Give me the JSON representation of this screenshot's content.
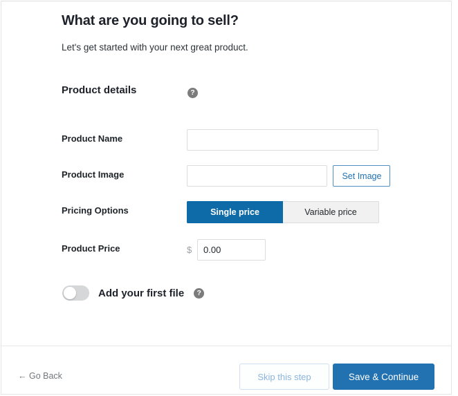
{
  "page": {
    "title": "What are you going to sell?",
    "subtitle": "Let's get started with your next great product."
  },
  "section": {
    "title": "Product details",
    "help_icon": "question-mark-icon",
    "help_glyph": "?"
  },
  "fields": {
    "product_name": {
      "label": "Product Name",
      "value": "",
      "placeholder": ""
    },
    "product_image": {
      "label": "Product Image",
      "value": "",
      "placeholder": "",
      "button_label": "Set Image"
    },
    "pricing_options": {
      "label": "Pricing Options",
      "options": [
        {
          "label": "Single price",
          "active": true
        },
        {
          "label": "Variable price",
          "active": false
        }
      ]
    },
    "product_price": {
      "label": "Product Price",
      "currency": "$",
      "value": "0.00",
      "placeholder": ""
    }
  },
  "file_toggle": {
    "label": "Add your first file",
    "state": "off",
    "help_glyph": "?"
  },
  "footer": {
    "go_back": "← Go Back",
    "skip": "Skip this step",
    "save": "Save & Continue"
  },
  "colors": {
    "accent_blue": "#0e6ba8",
    "primary_button": "#2271b1",
    "link_blue": "#2271b1",
    "skip_text": "#8ab4dd",
    "text_dark": "#1d2327",
    "muted": "#72777c"
  }
}
